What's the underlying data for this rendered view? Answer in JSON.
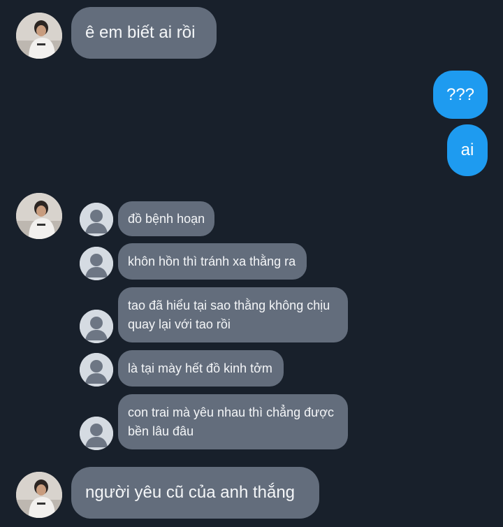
{
  "conversation": {
    "msg1": "ê em biết ai rồi",
    "msg2": "???",
    "msg3": "ai",
    "msg4": "đồ bệnh hoạn",
    "msg5": "khôn hồn thì tránh xa thằng ra",
    "msg6_line1": "tao đã hiểu tại sao thằng không chịu",
    "msg6_line2": "quay lại với tao rồi",
    "msg7": "là tại mày hết đồ kinh tởm",
    "msg8_line1": "con trai mà yêu nhau thì chẳng được",
    "msg8_line2": "bền lâu đâu",
    "msg9": "người yêu cũ của anh thắng"
  },
  "colors": {
    "background": "#18202b",
    "incoming_bubble": "#636d7c",
    "outgoing_bubble": "#1e9bf0",
    "placeholder_avatar": "#d5dbe2"
  },
  "icons": {
    "sender_avatar": "profile-photo",
    "quoted_avatar": "default-person-icon"
  }
}
